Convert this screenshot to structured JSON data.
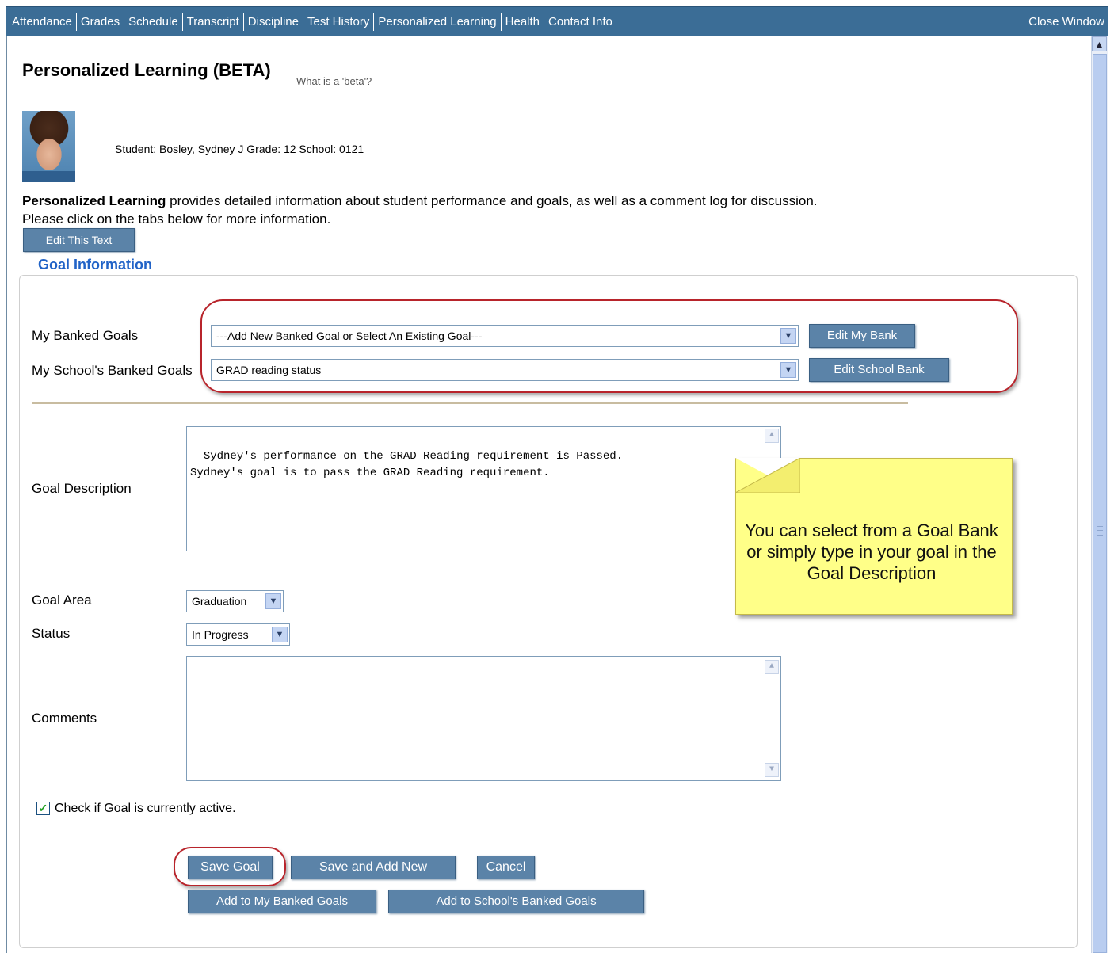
{
  "nav": {
    "tabs": [
      "Attendance",
      "Grades",
      "Schedule",
      "Transcript",
      "Discipline",
      "Test History",
      "Personalized Learning",
      "Health",
      "Contact Info"
    ],
    "close_label": "Close Window"
  },
  "page": {
    "title": "Personalized Learning (BETA)",
    "beta_link": "What is a 'beta'?"
  },
  "student": {
    "info": "Student: Bosley, Sydney J Grade: 12 School: 0121"
  },
  "intro": {
    "bold": "Personalized Learning",
    "line1_rest": " provides detailed information about student performance and goals, as well as a comment log for discussion.",
    "line2": "Please click on the tabs below for more information.",
    "edit_text_button": "Edit This Text"
  },
  "goal_section": {
    "legend": "Goal Information",
    "my_banked_label": "My Banked Goals",
    "my_banked_value": "---Add New Banked Goal or Select An Existing Goal---",
    "edit_my_bank": "Edit My Bank",
    "school_banked_label": "My School's Banked Goals",
    "school_banked_value": "GRAD reading status",
    "edit_school_bank": "Edit School Bank",
    "description_label": "Goal Description",
    "description_value": "Sydney's performance on the GRAD Reading requirement is Passed.\nSydney's goal is to pass the GRAD Reading requirement.",
    "area_label": "Goal Area",
    "area_value": "Graduation",
    "status_label": "Status",
    "status_value": "In Progress",
    "comments_label": "Comments",
    "comments_value": "",
    "active_checkbox_label": "Check if Goal is currently active.",
    "active_checked": true
  },
  "callout": {
    "text": "You can select from a Goal Bank or simply type in your goal in the Goal Description"
  },
  "actions": {
    "save_goal": "Save Goal",
    "save_add_new": "Save and Add New",
    "cancel": "Cancel",
    "add_my_banked": "Add to My Banked Goals",
    "add_school_banked": "Add to School's Banked Goals"
  },
  "colors": {
    "nav_bar": "#3b6d96",
    "button": "#5b83a8",
    "legend": "#2163c7",
    "highlight": "#b8242b",
    "callout": "#ffff88"
  }
}
